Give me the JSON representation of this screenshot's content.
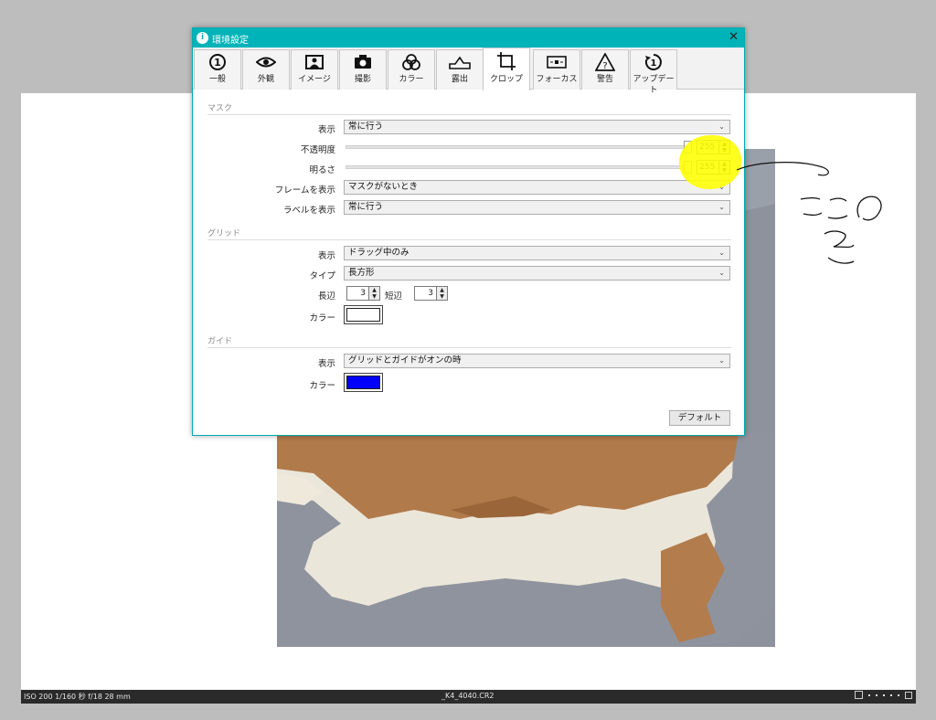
{
  "dialog": {
    "title": "環境設定",
    "tabs": [
      {
        "label": "一般",
        "icon": "general-icon"
      },
      {
        "label": "外観",
        "icon": "eye-icon"
      },
      {
        "label": "イメージ",
        "icon": "image-icon"
      },
      {
        "label": "撮影",
        "icon": "camera-icon"
      },
      {
        "label": "カラー",
        "icon": "color-circles-icon"
      },
      {
        "label": "露出",
        "icon": "exposure-icon"
      },
      {
        "label": "クロップ",
        "icon": "crop-icon"
      },
      {
        "label": "フォーカス",
        "icon": "focus-icon"
      },
      {
        "label": "警告",
        "icon": "warning-icon"
      },
      {
        "label": "アップデート",
        "icon": "update-icon"
      }
    ],
    "active_tab": "クロップ",
    "mask": {
      "heading": "マスク",
      "display_label": "表示",
      "display_value": "常に行う",
      "opacity_label": "不透明度",
      "opacity_value": "255",
      "brightness_label": "明るさ",
      "brightness_value": "255",
      "frame_label": "フレームを表示",
      "frame_value": "マスクがないとき",
      "label_label": "ラベルを表示",
      "label_value": "常に行う"
    },
    "grid": {
      "heading": "グリッド",
      "display_label": "表示",
      "display_value": "ドラッグ中のみ",
      "type_label": "タイプ",
      "type_value": "長方形",
      "long_side_label": "長辺",
      "long_side_value": "3",
      "short_side_label": "短辺",
      "short_side_value": "3",
      "color_label": "カラー",
      "color": "#ffffff"
    },
    "guide": {
      "heading": "ガイド",
      "display_label": "表示",
      "display_value": "グリッドとガイドがオンの時",
      "color_label": "カラー",
      "color": "#0000ff"
    },
    "default_button": "デフォルト"
  },
  "statusbar": {
    "exif": "ISO 200 1/160 秒 f/18 28 mm",
    "filename": "_K4_4040.CR2"
  },
  "colors": {
    "titlebar": "#00b3b8",
    "highlight": "#ffff00"
  }
}
